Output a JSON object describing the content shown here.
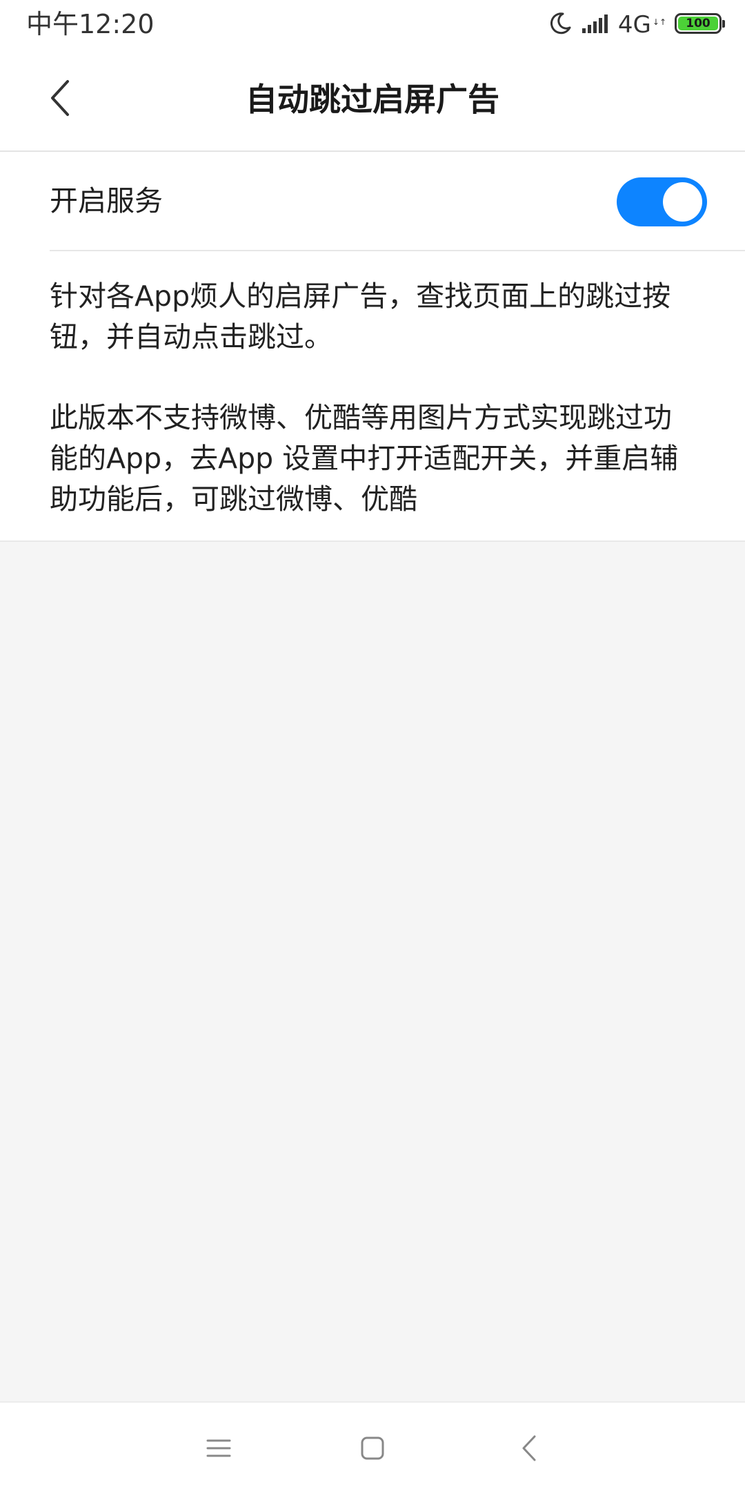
{
  "status_bar": {
    "time": "中午12:20",
    "network": "4G",
    "network_sub": "↓↑",
    "battery": "100",
    "icons": [
      "moon-icon",
      "signal-icon",
      "battery-icon"
    ]
  },
  "header": {
    "title": "自动跳过启屏广告",
    "back_icon": "chevron-left-icon"
  },
  "settings": {
    "service_label": "开启服务",
    "service_enabled": true,
    "toggle_color": "#0d84ff"
  },
  "description": {
    "paragraph_1": "针对各App烦人的启屏广告，查找页面上的跳过按钮，并自动点击跳过。",
    "paragraph_2": "此版本不支持微博、优酷等用图片方式实现跳过功能的App，去App 设置中打开适配开关，并重启辅助功能后，可跳过微博、优酷"
  },
  "nav_bar": {
    "icons": [
      "menu-icon",
      "home-icon",
      "back-icon"
    ]
  },
  "colors": {
    "accent": "#0d84ff",
    "battery": "#4cd137",
    "background": "#f5f5f5"
  }
}
